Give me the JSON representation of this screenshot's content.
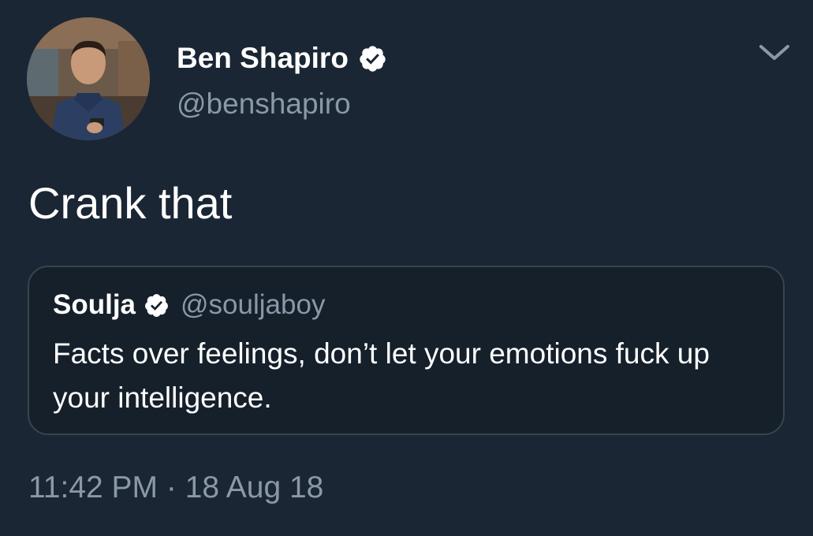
{
  "author": {
    "display_name": "Ben Shapiro",
    "handle": "@benshapiro",
    "verified": true
  },
  "tweet": {
    "text": "Crank that",
    "timestamp": "11:42 PM · 18 Aug 18"
  },
  "quoted_tweet": {
    "display_name": "Soulja",
    "handle": "@souljaboy",
    "verified": true,
    "text": "Facts over feelings, don’t let your emotions fuck up your intelligence."
  },
  "icons": {
    "verified": "verified-badge-icon",
    "menu": "chevron-down-icon"
  },
  "colors": {
    "background": "#1b2634",
    "secondary_text": "#8a98a7",
    "border": "#38444d"
  }
}
